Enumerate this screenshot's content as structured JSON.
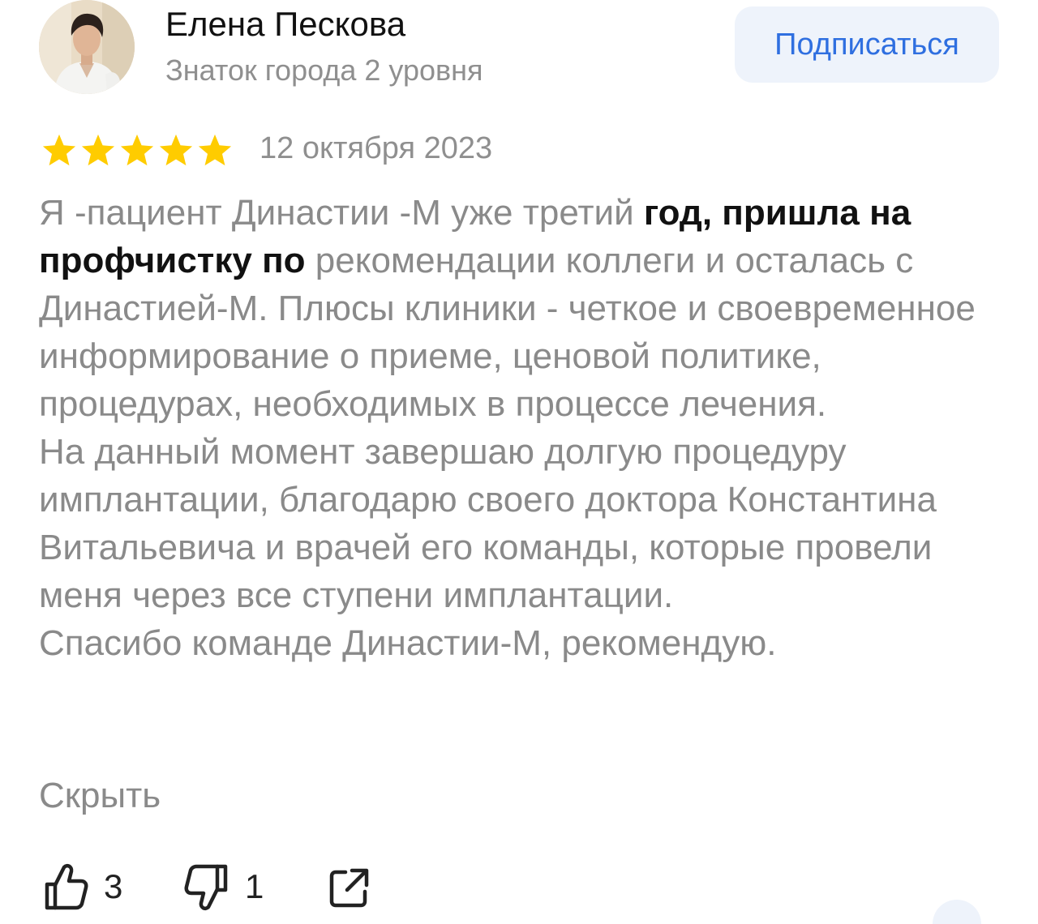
{
  "author": {
    "name": "Елена Пескова",
    "level": "Знаток города 2 уровня",
    "avatar_icon": "person-photo-avatar"
  },
  "subscribe_label": "Подписаться",
  "rating": {
    "stars": 5,
    "max": 5,
    "color": "#ffcc00"
  },
  "date": "12 октября 2023",
  "text": {
    "para1_lead": "Я -пациент Династии -М уже третий ",
    "para1_bold": "год, пришла на профчистку по",
    "para1_tail": " рекомендации коллеги и осталась с Династией-М. Плюсы клиники - четкое и своевременное информирование о приеме, ценовой политике, процедурах, необходимых в процессе лечения.",
    "para2": "На данный момент завершаю долгую процедуру имплантации, благодарю своего доктора Константина Витальевича и врачей его команды, которые провели меня через все ступени имплантации.",
    "para3": "Спасибо команде Династии-М, рекомендую."
  },
  "hide_label": "Скрыть",
  "reactions": {
    "likes": "3",
    "dislikes": "1",
    "like_icon": "thumbs-up-icon",
    "dislike_icon": "thumbs-down-icon",
    "share_icon": "share-icon"
  },
  "colors": {
    "accent": "#2f6fe0",
    "button_bg": "#eef3fb",
    "text_muted": "#8a8a8a",
    "text_dark": "#111111"
  }
}
